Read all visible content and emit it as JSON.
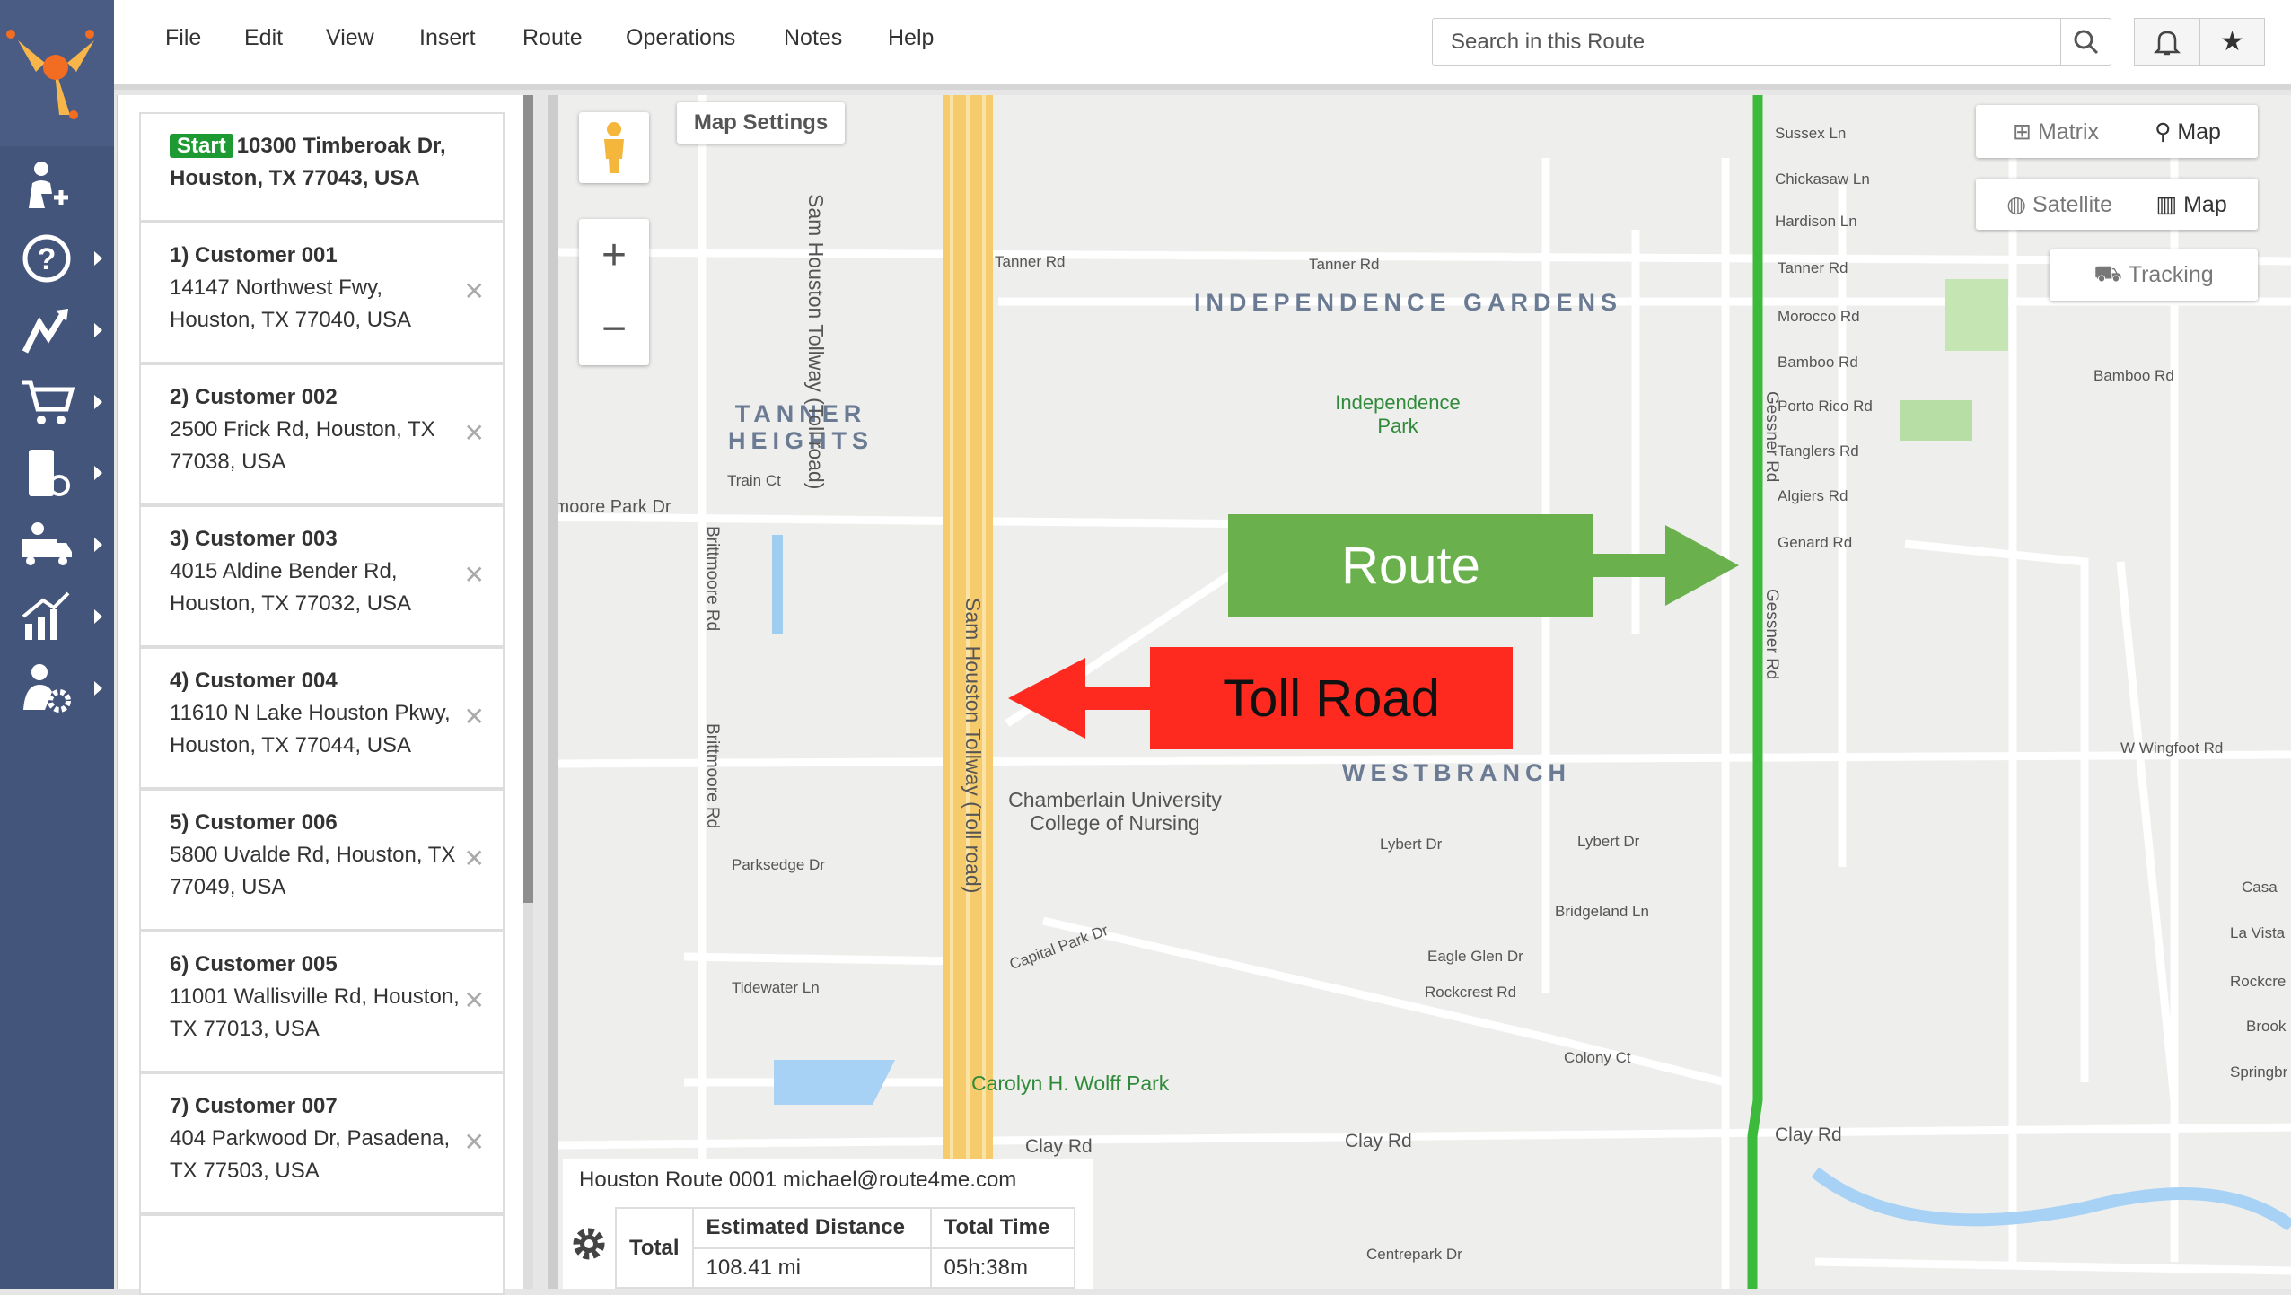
{
  "sidebar": {
    "items": [
      {
        "icon": "add-user-icon"
      },
      {
        "icon": "help-icon"
      },
      {
        "icon": "route-icon"
      },
      {
        "icon": "cart-icon"
      },
      {
        "icon": "scanner-icon"
      },
      {
        "icon": "fleet-icon"
      },
      {
        "icon": "analytics-icon"
      },
      {
        "icon": "user-settings-icon"
      }
    ]
  },
  "menu": [
    "File",
    "Edit",
    "View",
    "Insert",
    "Route",
    "Operations",
    "Notes",
    "Help"
  ],
  "search": {
    "placeholder": "Search in this Route"
  },
  "stops": {
    "start_badge": "Start",
    "start_address": "10300 Timberoak Dr, Houston, TX 77043, USA",
    "items": [
      {
        "title": "1) Customer 001",
        "address": "14147 Northwest Fwy, Houston, TX 77040, USA"
      },
      {
        "title": "2) Customer 002",
        "address": "2500 Frick Rd, Houston, TX 77038, USA"
      },
      {
        "title": "3) Customer 003",
        "address": "4015 Aldine Bender Rd, Houston, TX 77032, USA"
      },
      {
        "title": "4) Customer 004",
        "address": "11610 N Lake Houston Pkwy, Houston, TX 77044, USA"
      },
      {
        "title": "5) Customer 006",
        "address": "5800 Uvalde Rd, Houston, TX 77049, USA"
      },
      {
        "title": "6) Customer 005",
        "address": "11001 Wallisville Rd, Houston, TX 77013, USA"
      },
      {
        "title": "7) Customer 007",
        "address": "404 Parkwood Dr, Pasadena, TX 77503, USA"
      }
    ]
  },
  "map": {
    "settings": "Map Settings",
    "matrix": "Matrix",
    "map": "Map",
    "satellite": "Satellite",
    "map2": "Map",
    "tracking": "Tracking",
    "route_label": "Route",
    "toll_label": "Toll Road",
    "route_color": "#6ab04c",
    "toll_color": "#ff2a1f",
    "route_line_color": "#3cba3c",
    "labels": [
      "Tanner Rd",
      "Tanner Rd",
      "INDEPENDENCE GARDENS",
      "TANNER HEIGHTS",
      "Independence Park",
      "tmoore Park Dr",
      "Train Ct",
      "WESTBRANCH",
      "Chamberlain University College of Nursing",
      "Lybert Dr",
      "Lybert Dr",
      "Parksedge Dr",
      "Tidewater Ln",
      "Capital Park Dr",
      "Eagle Glen Dr",
      "Rockcrest Rd",
      "Bridgeland Ln",
      "Colony Ct",
      "Carolyn H. Wolff Park",
      "Clay Rd",
      "Clay Rd",
      "Clay Rd",
      "Centrepark Dr",
      "Sussex Ln",
      "Chickasaw Ln",
      "Hardison Ln",
      "Tanner Rd",
      "Morocco Rd",
      "Bamboo Rd",
      "Porto Rico Rd",
      "Tanglers Rd",
      "Algiers Rd",
      "Genard Rd",
      "Bamboo Rd",
      "W Wingfoot Rd",
      "Casa",
      "La Vista",
      "Rockcre",
      "Brook",
      "Springbr",
      "Sam Houston Tollway (Toll road)",
      "Sam Houston Tollway (Toll road)",
      "Brittmoore Rd",
      "Brittmoore Rd",
      "Gessner Rd",
      "Gessner Rd"
    ]
  },
  "summary": {
    "route_name": "Houston Route 0001 michael@route4me.com",
    "total": "Total",
    "dist_header": "Estimated Distance",
    "time_header": "Total Time",
    "distance": "108.41 mi",
    "time": "05h:38m"
  }
}
